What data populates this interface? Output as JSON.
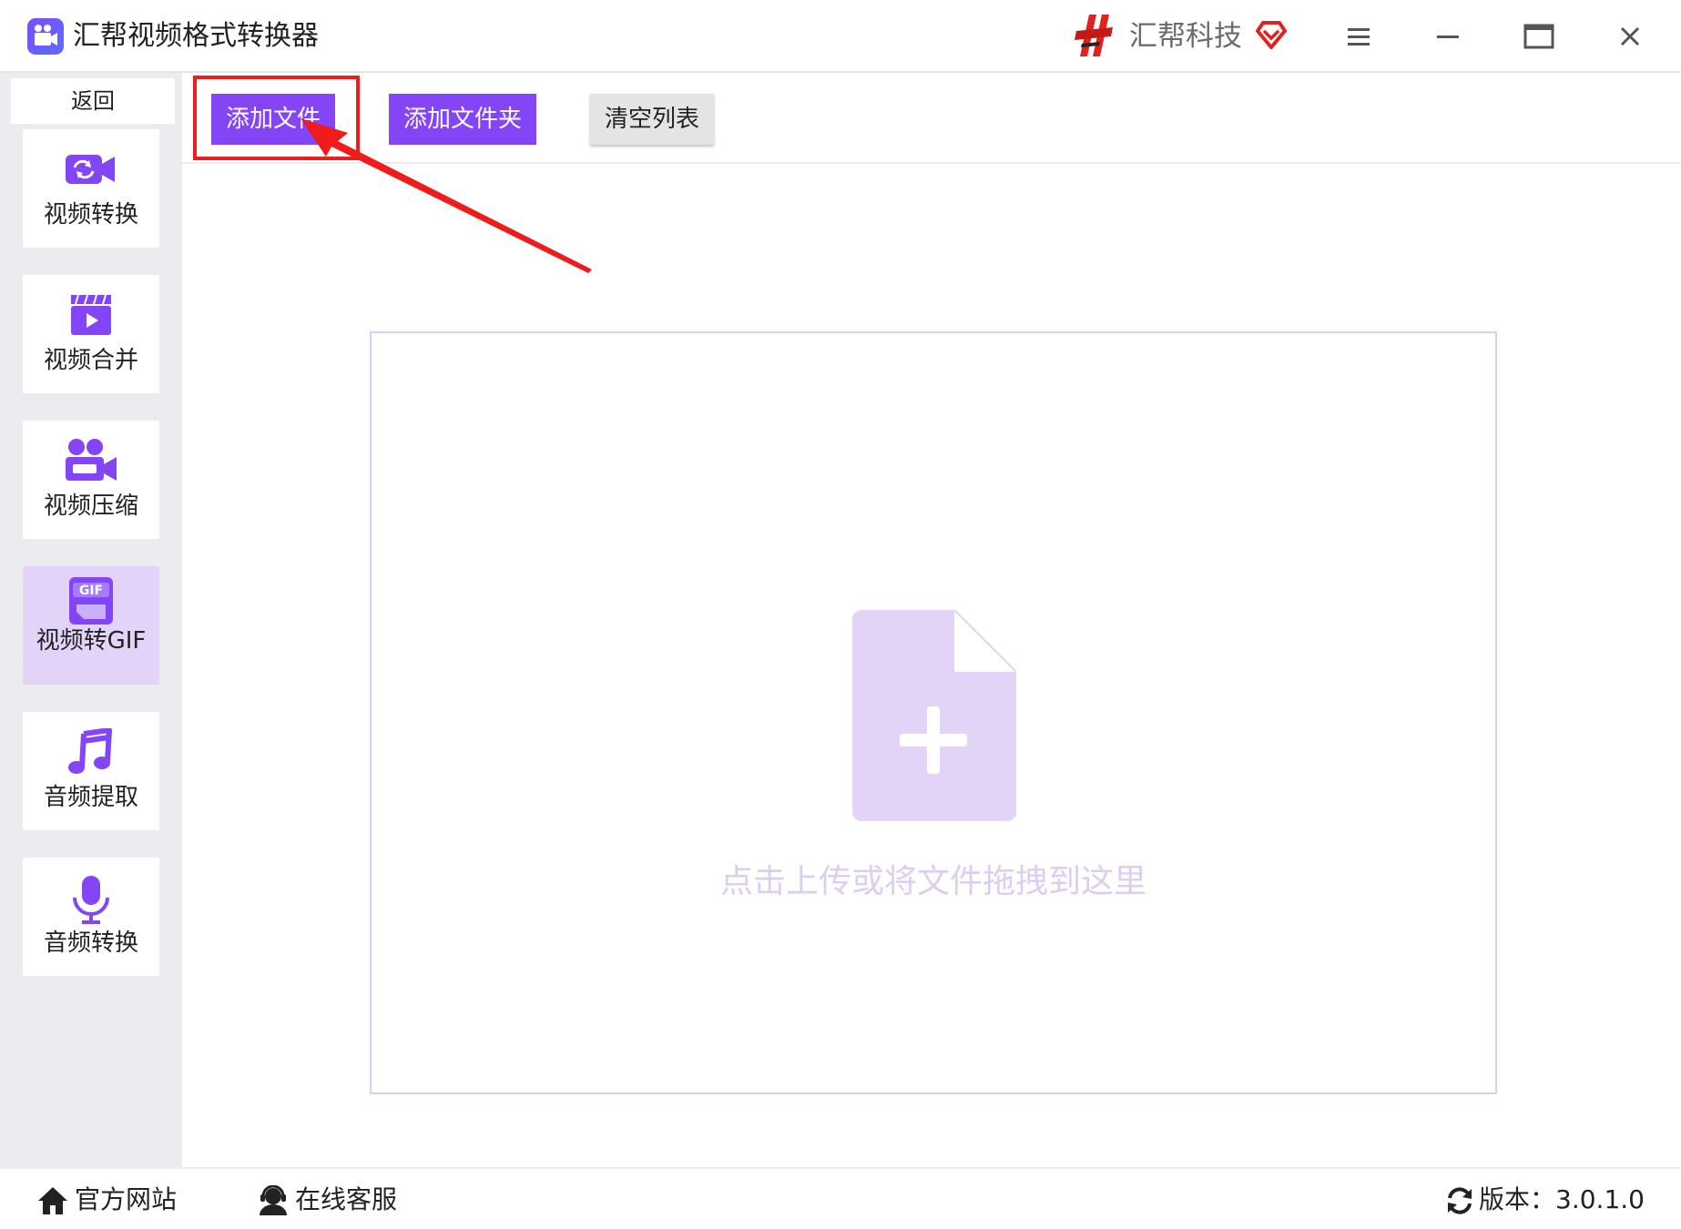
{
  "window": {
    "title": "汇帮视频格式转换器",
    "brand": "汇帮科技"
  },
  "sidebar": {
    "back_label": "返回",
    "items": [
      {
        "label": "视频转换",
        "icon": "video-convert-icon"
      },
      {
        "label": "视频合并",
        "icon": "video-merge-icon"
      },
      {
        "label": "视频压缩",
        "icon": "video-compress-icon"
      },
      {
        "label": "视频转GIF",
        "icon": "gif-icon"
      },
      {
        "label": "音频提取",
        "icon": "music-note-icon"
      },
      {
        "label": "音频转换",
        "icon": "microphone-icon"
      }
    ],
    "active_index": 3
  },
  "toolbar": {
    "add_file_label": "添加文件",
    "add_folder_label": "添加文件夹",
    "clear_label": "清空列表"
  },
  "dropzone": {
    "hint": "点击上传或将文件拖拽到这里",
    "icon": "file-add-icon"
  },
  "footer": {
    "website_label": "官方网站",
    "service_label": "在线客服",
    "version_label": "版本：3.0.1.0"
  },
  "colors": {
    "accent": "#8345f5",
    "active_nav": "#e2d4f8",
    "dropzone_border": "#dcccf4",
    "hint_text": "#ddcdf3",
    "annotation": "#f01b1b"
  }
}
